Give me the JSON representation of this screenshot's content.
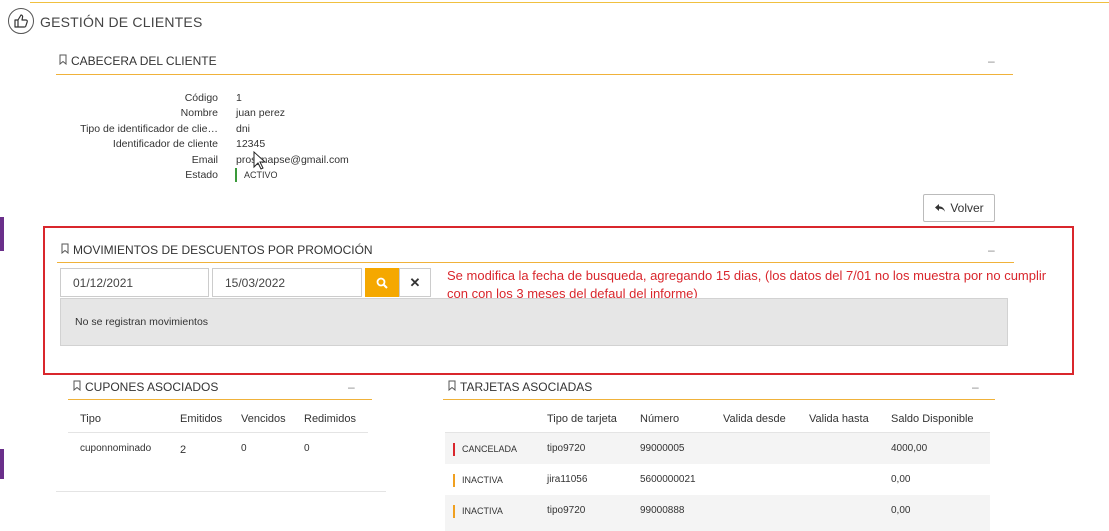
{
  "page": {
    "title": "GESTIÓN DE CLIENTES"
  },
  "cabecera": {
    "title": "CABECERA DEL CLIENTE",
    "collapse": "–",
    "fields": [
      {
        "label": "Código",
        "value": "1"
      },
      {
        "label": "Nombre",
        "value": "juan perez"
      },
      {
        "label": "Tipo de identificador de clie…",
        "value": "dni"
      },
      {
        "label": "Identificador de cliente",
        "value": "12345"
      },
      {
        "label": "Email",
        "value": "prosynapse@gmail.com"
      },
      {
        "label": "Estado",
        "value": "ACTIVO"
      }
    ],
    "status_color": "#3a9a3a",
    "volver_label": "Volver"
  },
  "movimientos": {
    "title": "MOVIMIENTOS DE DESCUENTOS POR PROMOCIÓN",
    "collapse": "–",
    "date_from": "01/12/2021",
    "date_to": "15/03/2022",
    "search_icon": "search-icon",
    "clear_label": "✕",
    "empty_message": "No se registran movimientos",
    "note": "Se modifica la fecha de busqueda, agregando 15 dias, (los datos del 7/01 no los muestra por no cumplir con con los 3 meses del defaul del informe)"
  },
  "cupones": {
    "title": "CUPONES ASOCIADOS",
    "collapse": "–",
    "headers": [
      "Tipo",
      "Emitidos",
      "Vencidos",
      "Redimidos"
    ],
    "rows": [
      {
        "tipo": "cuponnominado",
        "emitidos": "2",
        "vencidos": "0",
        "redimidos": "0"
      }
    ]
  },
  "tarjetas": {
    "title": "TARJETAS ASOCIADAS",
    "collapse": "–",
    "headers": [
      "Tipo de tarjeta",
      "Número",
      "Valida desde",
      "Valida hasta",
      "Saldo Disponible"
    ],
    "rows": [
      {
        "estado": "CANCELADA",
        "tipo": "tipo9720",
        "numero": "99000005",
        "saldo": "4000,00",
        "color": "#d9262c"
      },
      {
        "estado": "INACTIVA",
        "tipo": "jira11056",
        "numero": "5600000021",
        "saldo": "0,00",
        "color": "#f0a020"
      },
      {
        "estado": "INACTIVA",
        "tipo": "tipo9720",
        "numero": "99000888",
        "saldo": "0,00",
        "color": "#f0a020"
      }
    ]
  },
  "colors": {
    "accent": "#f0b23a",
    "brand_bar": "#6a2f8a",
    "highlight_box": "#d9262c",
    "search_button": "#f5a800"
  }
}
